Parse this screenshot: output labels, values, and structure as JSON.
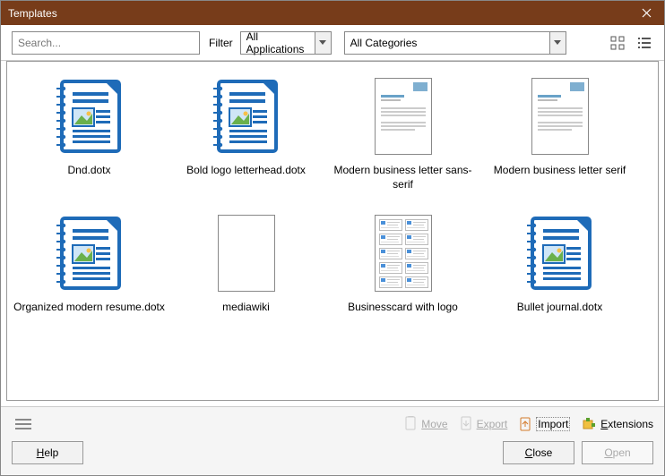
{
  "window": {
    "title": "Templates"
  },
  "toolbar": {
    "search_placeholder": "Search...",
    "filter_label": "Filter",
    "applications": {
      "value": "All Applications"
    },
    "categories": {
      "value": "All Categories"
    }
  },
  "templates": [
    {
      "label": "Dnd.dotx",
      "kind": "writer"
    },
    {
      "label": "Bold logo letterhead.dotx",
      "kind": "writer"
    },
    {
      "label": "Modern business letter sans-serif",
      "kind": "letter-sans"
    },
    {
      "label": "Modern business letter serif",
      "kind": "letter-serif"
    },
    {
      "label": "Organized modern resume.dotx",
      "kind": "writer"
    },
    {
      "label": "mediawiki",
      "kind": "blank"
    },
    {
      "label": "Businesscard with logo",
      "kind": "cards"
    },
    {
      "label": "Bullet journal.dotx",
      "kind": "writer"
    }
  ],
  "footer": {
    "move": "Move",
    "export": "Export",
    "import": "Import",
    "extensions": "Extensions",
    "help": "Help",
    "close": "Close",
    "open": "Open"
  }
}
